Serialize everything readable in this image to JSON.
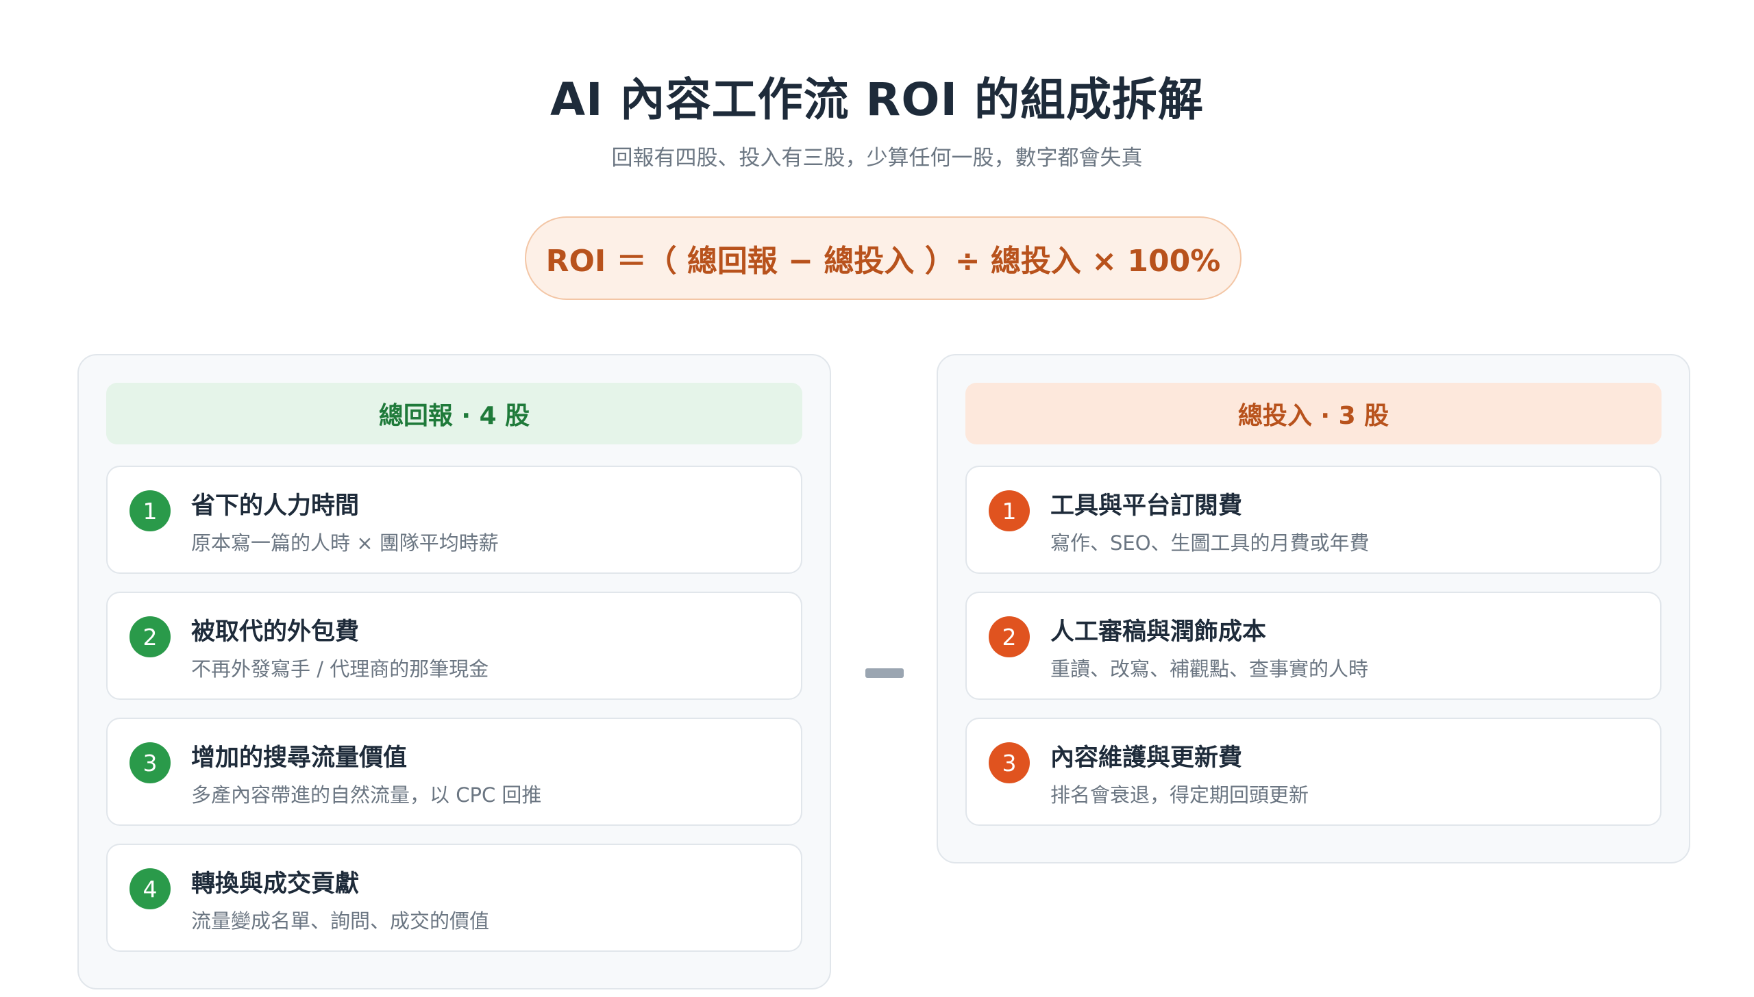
{
  "title": "AI 內容工作流 ROI 的組成拆解",
  "subtitle": "回報有四股、投入有三股，少算任何一股，數字都會失真",
  "formula": "ROI ＝（ 總回報 − 總投入 ）÷ 總投入 × 100%",
  "returns": {
    "header": "總回報 · 4 股",
    "items": [
      {
        "num": "1",
        "title": "省下的人力時間",
        "desc": "原本寫一篇的人時 × 團隊平均時薪"
      },
      {
        "num": "2",
        "title": "被取代的外包費",
        "desc": "不再外發寫手 / 代理商的那筆現金"
      },
      {
        "num": "3",
        "title": "增加的搜尋流量價值",
        "desc": "多產內容帶進的自然流量，以 CPC 回推"
      },
      {
        "num": "4",
        "title": "轉換與成交貢獻",
        "desc": "流量變成名單、詢問、成交的價值"
      }
    ]
  },
  "costs": {
    "header": "總投入 · 3 股",
    "items": [
      {
        "num": "1",
        "title": "工具與平台訂閱費",
        "desc": "寫作、SEO、生圖工具的月費或年費"
      },
      {
        "num": "2",
        "title": "人工審稿與潤飾成本",
        "desc": "重讀、改寫、補觀點、查事實的人時"
      },
      {
        "num": "3",
        "title": "內容維護與更新費",
        "desc": "排名會衰退，得定期回頭更新"
      }
    ]
  },
  "colors": {
    "returns_accent": "#2a9a4a",
    "costs_accent": "#e0531f",
    "formula_text": "#b8521c"
  }
}
